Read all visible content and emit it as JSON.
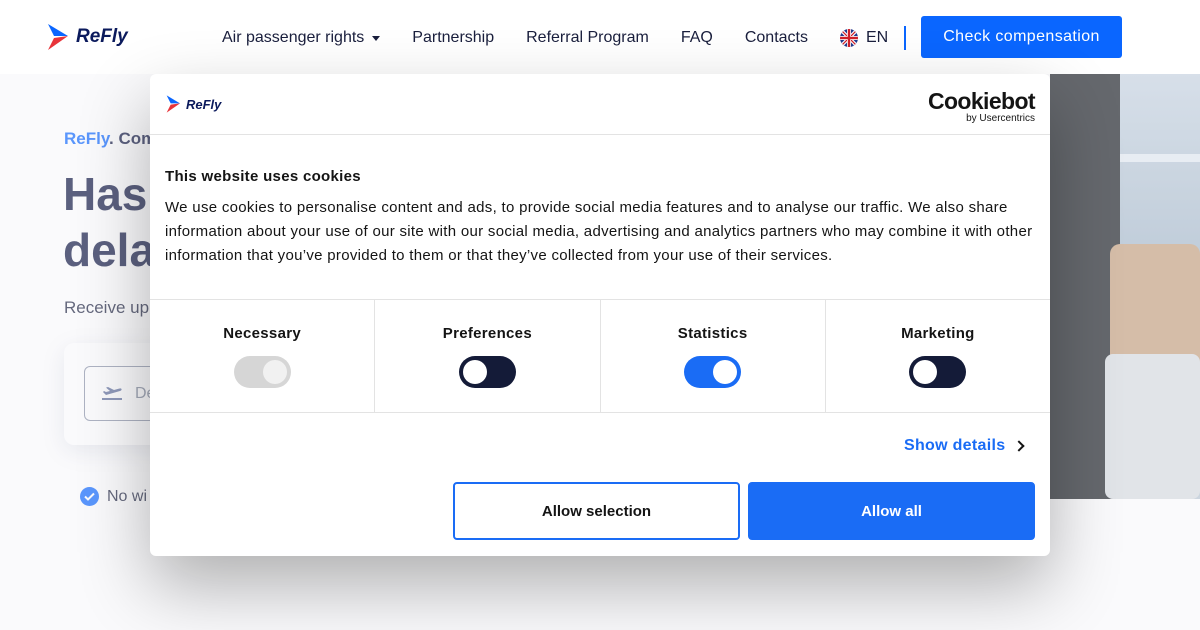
{
  "brand": {
    "name": "ReFly",
    "accent": "#0a66ff",
    "navy": "#0b1340"
  },
  "header": {
    "nav": [
      {
        "label": "Air passenger rights",
        "has_dropdown": true
      },
      {
        "label": "Partnership"
      },
      {
        "label": "Referral Program"
      },
      {
        "label": "FAQ"
      },
      {
        "label": "Contacts"
      }
    ],
    "language": {
      "code": "EN",
      "flag_icon": "uk-flag-icon"
    },
    "cta_label": "Check compensation"
  },
  "hero": {
    "eyebrow_brand": "ReFly",
    "eyebrow_rest": ". Com",
    "title_line1": "Has",
    "title_line2": "dela",
    "subtitle": "Receive up",
    "search_placeholder": "De",
    "search_icon": "plane-departure-icon",
    "feature_check": "No wi"
  },
  "cookie_dialog": {
    "provider_main": "Cookiebot",
    "provider_by": "by Usercentrics",
    "title": "This website uses cookies",
    "body": "We use cookies to personalise content and ads, to provide social media features and to analyse our traffic. We also share information about your use of our site with our social media, advertising and analytics partners who may combine it with other information that you’ve provided to them or that they’ve collected from your use of their services.",
    "categories": [
      {
        "label": "Necessary",
        "state": "on",
        "disabled": true
      },
      {
        "label": "Preferences",
        "state": "off",
        "disabled": false
      },
      {
        "label": "Statistics",
        "state": "on",
        "disabled": false
      },
      {
        "label": "Marketing",
        "state": "off",
        "disabled": false
      }
    ],
    "show_details_label": "Show details",
    "allow_selection_label": "Allow selection",
    "allow_all_label": "Allow all",
    "button_color": "#1a6cf5"
  }
}
